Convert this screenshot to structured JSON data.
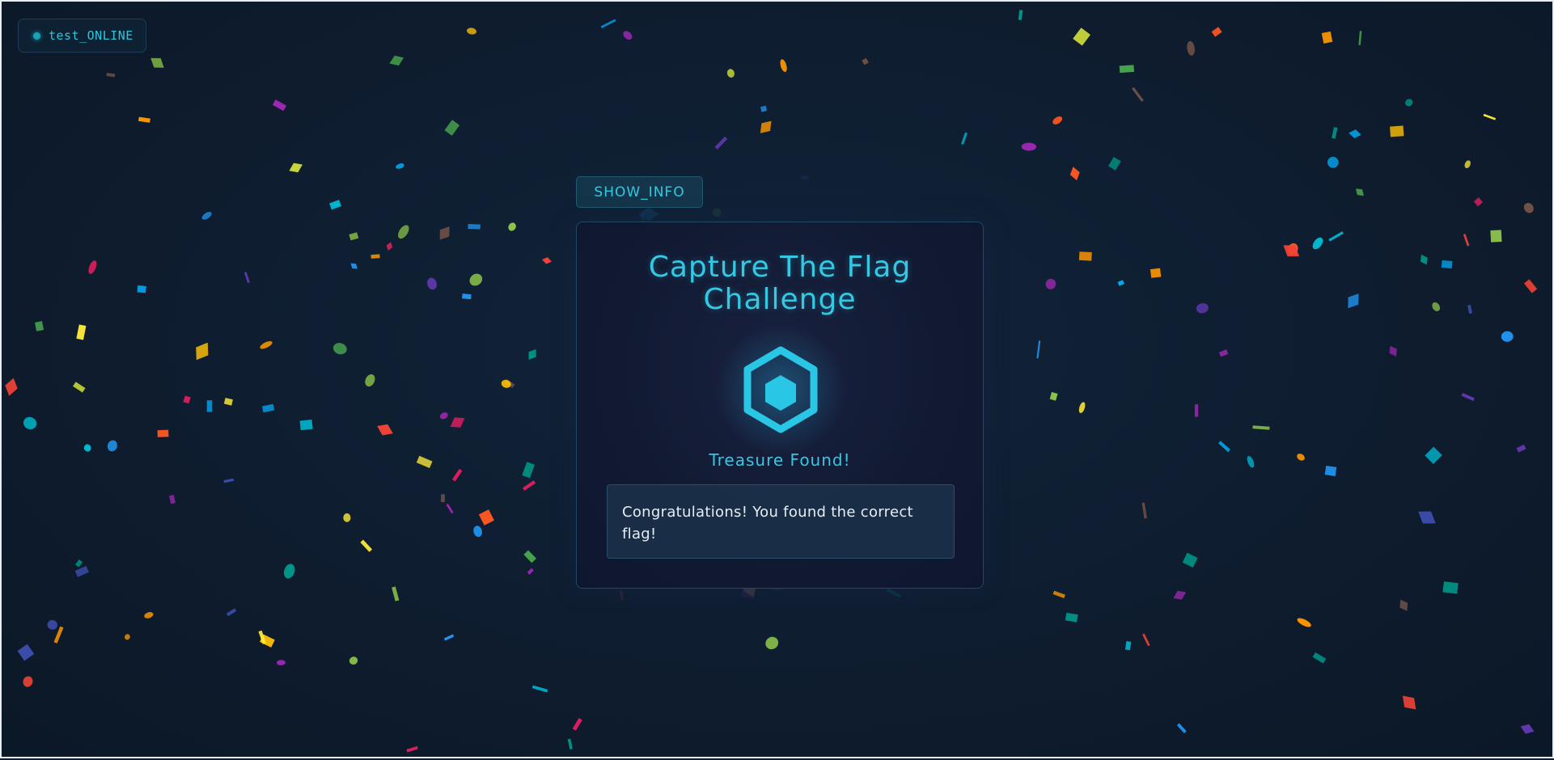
{
  "status": {
    "label": "test_ONLINE",
    "dot_color": "#1aa3b8"
  },
  "toolbar": {
    "show_info_label": "SHOW_INFO"
  },
  "card": {
    "title": "Capture The Flag Challenge",
    "icon": "hexagon-badge-icon",
    "status_label": "Treasure Found!",
    "message": "Congratulations! You found the correct flag!"
  },
  "theme": {
    "accent": "#33c8e3",
    "background": "#0f1e30",
    "card_background": "#131b35"
  },
  "confetti_colors": [
    "#f44336",
    "#e91e63",
    "#9c27b0",
    "#673ab7",
    "#3f51b5",
    "#2196f3",
    "#03a9f4",
    "#00bcd4",
    "#009688",
    "#4caf50",
    "#8bc34a",
    "#cddc39",
    "#ffeb3b",
    "#ffc107",
    "#ff9800",
    "#ff5722",
    "#795548"
  ]
}
